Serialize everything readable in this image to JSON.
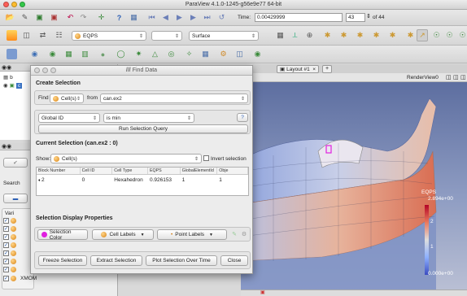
{
  "window": {
    "title": "ParaView 4.1.0-1245-g56e9e77 64-bit",
    "lights": [
      "#fc5f57",
      "#fdbc2e",
      "#34c84a"
    ]
  },
  "toolbar1": {
    "icons": [
      "open-icon",
      "save-state-icon",
      "connect-icon",
      "disconnect-icon",
      "undo-icon",
      "redo-icon",
      "reset-camera-icon",
      "help-icon",
      "filter-icon",
      "first-frame-icon",
      "prev-frame-icon",
      "play-icon",
      "next-frame-icon",
      "last-frame-icon",
      "loop-icon"
    ],
    "time_label": "Time:",
    "time_value": "0.00429999",
    "frame_value": "43",
    "frame_of": "of 44"
  },
  "toolbar2": {
    "variable_combo": "EQPS",
    "component_combo": "",
    "representation_combo": "Surface"
  },
  "pipeline": {
    "row1": "b",
    "row2": "c"
  },
  "properties": {
    "search_placeholder": "Search",
    "search_label": "Search",
    "variables_header": "Vari",
    "items": [
      "",
      "",
      "",
      "",
      "",
      "",
      ""
    ],
    "xmom_label": "XMOM"
  },
  "layout": {
    "tab_label": "Layout #1",
    "close_glyph": "×",
    "add_tab": "+",
    "render_view_label": "RenderView0"
  },
  "find_dialog": {
    "title": "Find Data",
    "create_selection_title": "Create Selection",
    "find_label": "Find",
    "find_type": "Cell(s)",
    "from_label": "from",
    "from_source": "can.ex2",
    "attribute_combo": "Global ID",
    "operator_combo": "is min",
    "help_button": "?",
    "run_query_button": "Run Selection Query",
    "current_selection_title": "Current Selection (can.ex2 : 0)",
    "show_label": "Show:",
    "show_type": "Cell(s)",
    "invert_label": "Invert selection",
    "table": {
      "columns": [
        "Block Number",
        "Cell ID",
        "Cell Type",
        "EQPS",
        "GlobalElementId",
        "Obje"
      ],
      "rows": [
        [
          "2",
          "0",
          "Hexahedron",
          "0.926153",
          "1",
          "1"
        ]
      ]
    },
    "display_props_title": "Selection Display Properties",
    "selection_color_button": "Selection Color",
    "cell_labels_button": "Cell Labels",
    "point_labels_button": "Point Labels",
    "freeze_button": "Freeze Selection",
    "extract_button": "Extract Selection",
    "plot_button": "Plot Selection Over Time",
    "close_button": "Close"
  },
  "scalar_bar": {
    "title": "EQPS",
    "max_label": "2.894e+00",
    "tick_2": "2",
    "tick_1": "1",
    "min_label": "0.000e+00"
  }
}
